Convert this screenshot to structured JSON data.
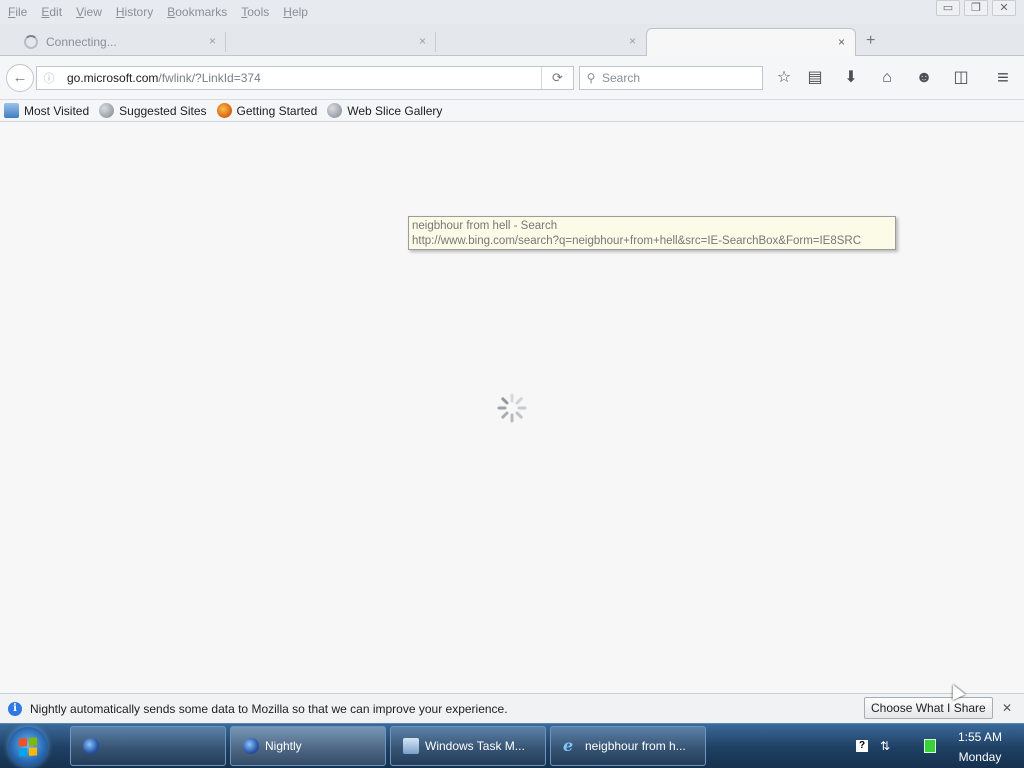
{
  "menubar": {
    "items": [
      {
        "label": "File",
        "key": "F",
        "rest": "ile"
      },
      {
        "label": "Edit",
        "key": "E",
        "rest": "dit"
      },
      {
        "label": "View",
        "key": "V",
        "rest": "iew"
      },
      {
        "label": "History",
        "key": "H",
        "rest": "istory"
      },
      {
        "label": "Bookmarks",
        "key": "B",
        "rest": "ookmarks"
      },
      {
        "label": "Tools",
        "key": "T",
        "rest": "ools"
      },
      {
        "label": "Help",
        "key": "H",
        "rest": "elp"
      }
    ]
  },
  "window_controls": {
    "minimize": "▭",
    "restore": "❐",
    "close": "✕"
  },
  "tabs": [
    {
      "title": "Connecting...",
      "close": "×",
      "loading": true
    },
    {
      "title": "",
      "close": "×"
    },
    {
      "title": "",
      "close": "×"
    },
    {
      "title": "",
      "close": "×",
      "active": true
    }
  ],
  "new_tab": "+",
  "navbar": {
    "back": "←",
    "info": "ⓘ",
    "url_host": "go.microsoft.com",
    "url_path": "/fwlink/?LinkId=374",
    "reload": "⟳",
    "search_placeholder": "Search",
    "search_glyph": "⚲",
    "icons": {
      "bookmark_star": "☆",
      "reading_list": "▤",
      "download": "⬇",
      "home": "⌂",
      "hello": "☻",
      "pocket": "◫",
      "menu": "≡"
    }
  },
  "bookmarks": [
    {
      "label": "Most Visited",
      "icon": "folder-icon"
    },
    {
      "label": "Suggested Sites",
      "icon": "globe-icon"
    },
    {
      "label": "Getting Started",
      "icon": "firefox-icon"
    },
    {
      "label": "Web Slice Gallery",
      "icon": "globe-icon"
    }
  ],
  "tooltip": {
    "title": "neigbhour from hell - Search",
    "url": "http://www.bing.com/search?q=neigbhour+from+hell&src=IE-SearchBox&Form=IE8SRC"
  },
  "notification": {
    "text": "Nightly automatically sends some data to Mozilla so that we can improve your experience.",
    "button": "Choose What I Share",
    "close": "✕",
    "info_glyph": "i"
  },
  "taskbar": {
    "tasks": [
      {
        "label": "",
        "icon": "firefox-icon"
      },
      {
        "label": "Nightly",
        "icon": "nightly-icon"
      },
      {
        "label": "Windows Task M...",
        "icon": "task-manager-icon"
      },
      {
        "label": "neigbhour from h...",
        "icon": "ie-icon"
      }
    ],
    "ie_glyph": "e",
    "tray": {
      "help": "?",
      "arrows": "⇅"
    },
    "clock": {
      "time": "1:55 AM",
      "day": "Monday"
    },
    "flag_colors": [
      "#f25022",
      "#7fba00",
      "#00a4ef",
      "#ffb900"
    ]
  }
}
